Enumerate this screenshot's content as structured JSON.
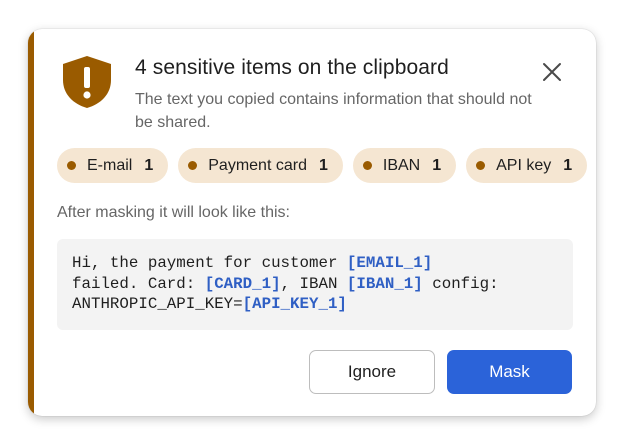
{
  "dialog": {
    "title": "4 sensitive items on the clipboard",
    "subtitle": "The text you copied contains information that should not be shared.",
    "shield_icon": "shield-exclamation-icon",
    "close_icon": "close-icon"
  },
  "chips": [
    {
      "label": "E-mail",
      "count": "1"
    },
    {
      "label": "Payment card",
      "count": "1"
    },
    {
      "label": "IBAN",
      "count": "1"
    },
    {
      "label": "API key",
      "count": "1"
    }
  ],
  "preview": {
    "label": "After masking it will look like this:",
    "line1_text": "Hi, the payment for customer ",
    "line1_token": "[EMAIL_1]",
    "line2_text_a": "failed. Card: ",
    "line2_token_a": "[CARD_1]",
    "line2_text_b": ", IBAN ",
    "line2_token_b": "[IBAN_1]",
    "line2_text_c": " config:",
    "line3_text": "ANTHROPIC_API_KEY=",
    "line3_token": "[API_KEY_1]"
  },
  "buttons": {
    "ignore_label": "Ignore",
    "mask_label": "Mask"
  },
  "colors": {
    "accent": "#9a5b00",
    "chip_background": "#f5e6d2",
    "token": "#2f5fc4",
    "primary_button": "#2b63d9"
  }
}
